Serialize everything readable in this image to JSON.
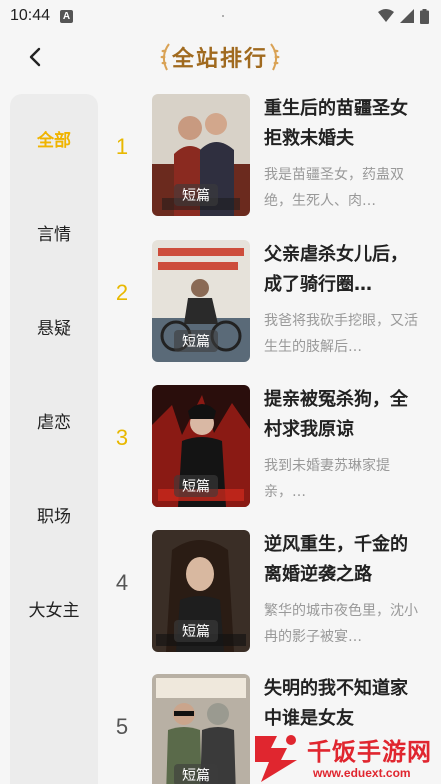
{
  "status_bar": {
    "time": "10:44",
    "app_badge": "A"
  },
  "header": {
    "back_icon": "chevron-left-icon",
    "title": "全站排行"
  },
  "sidebar": {
    "items": [
      {
        "label": "全部",
        "active": true
      },
      {
        "label": "言情",
        "active": false
      },
      {
        "label": "悬疑",
        "active": false
      },
      {
        "label": "虐恋",
        "active": false
      },
      {
        "label": "职场",
        "active": false
      },
      {
        "label": "大女主",
        "active": false
      }
    ]
  },
  "books": [
    {
      "rank": "1",
      "title": "重生后的苗疆圣女拒救未婚夫",
      "desc": "我是苗疆圣女，药蛊双绝，生死人、肉…",
      "badge": "短篇"
    },
    {
      "rank": "2",
      "title": "父亲虐杀女儿后，成了骑行圈…",
      "desc": "我爸将我砍手挖眼，又活生生的肢解后…",
      "badge": "短篇"
    },
    {
      "rank": "3",
      "title": "提亲被冤杀狗，全村求我原谅",
      "desc": "我到未婚妻苏琳家提亲，…",
      "badge": "短篇"
    },
    {
      "rank": "4",
      "title": "逆风重生，千金的离婚逆袭之路",
      "desc": "繁华的城市夜色里，沈小冉的影子被宴…",
      "badge": "短篇"
    },
    {
      "rank": "5",
      "title": "失明的我不知道家中谁是女友",
      "desc": "",
      "badge": "短篇"
    }
  ],
  "watermark": {
    "text": "千饭手游网",
    "url": "www.eduext.com"
  },
  "colors": {
    "accent": "#f0b400",
    "title_brown": "#a06a1f",
    "desc_gray": "#999999",
    "watermark_red": "#e0262f"
  }
}
